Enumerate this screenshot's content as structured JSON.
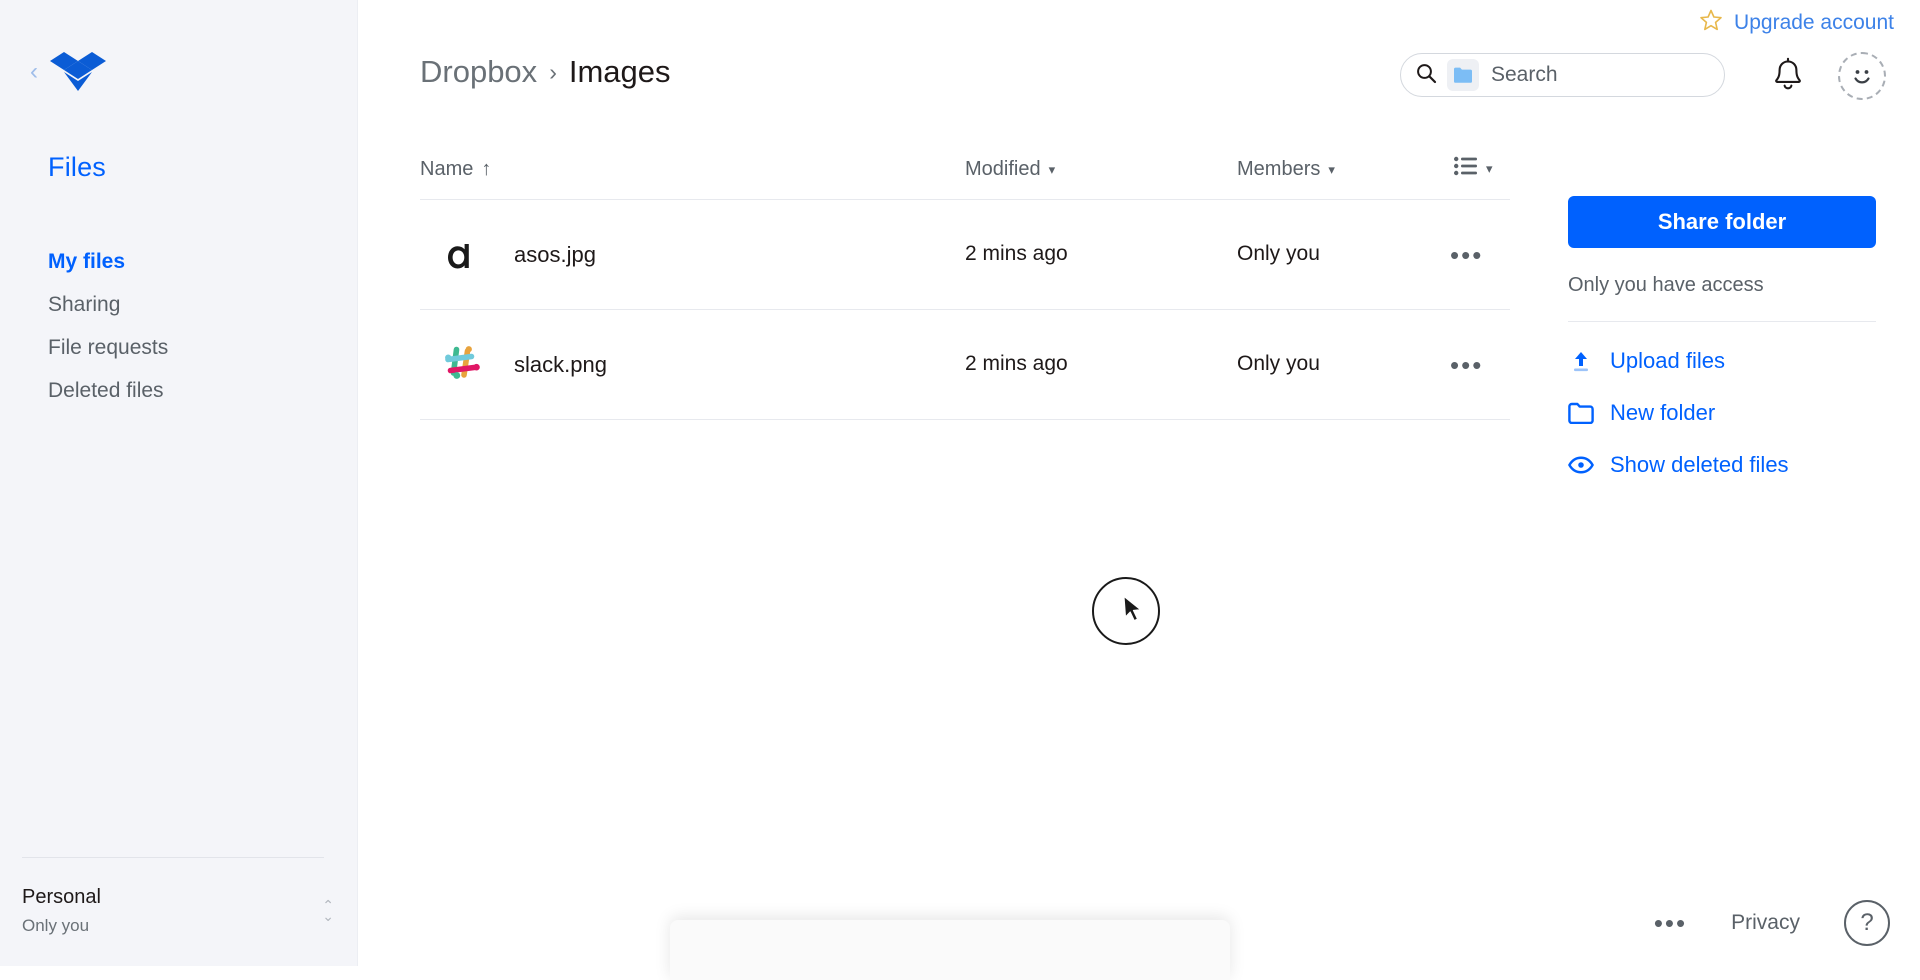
{
  "app": {
    "name": "Dropbox",
    "logo_color": "#0061fe"
  },
  "sidebar": {
    "collapse_icon": "chevron-left-icon",
    "logo_icon": "dropbox-logo-icon",
    "heading": "Files",
    "items": [
      {
        "label": "My files",
        "active": true
      },
      {
        "label": "Sharing",
        "active": false
      },
      {
        "label": "File requests",
        "active": false
      },
      {
        "label": "Deleted files",
        "active": false
      }
    ],
    "account": {
      "name": "Personal",
      "sub": "Only you",
      "stepper_up": "⌃",
      "stepper_down": "⌄"
    }
  },
  "topbar": {
    "upgrade": {
      "icon": "star-icon",
      "label": "Upgrade account",
      "color": "#3d82e8"
    },
    "search": {
      "icon": "search-icon",
      "chip_icon": "folder-icon",
      "placeholder": "Search",
      "value": ""
    },
    "notifications_icon": "bell-icon",
    "avatar_icon": "smiley-avatar-icon"
  },
  "breadcrumb": {
    "root": "Dropbox",
    "separator": "›",
    "current": "Images"
  },
  "table": {
    "columns": {
      "name": {
        "label": "Name",
        "sort_indicator": "↑"
      },
      "modified": {
        "label": "Modified",
        "caret": "▾"
      },
      "members": {
        "label": "Members",
        "caret": "▾"
      },
      "view": {
        "icon": "list-view-icon",
        "caret": "▾"
      }
    },
    "rows": [
      {
        "icon": "asos-logo-icon",
        "name": "asos.jpg",
        "modified": "2 mins ago",
        "members": "Only you",
        "more": "•••"
      },
      {
        "icon": "slack-logo-icon",
        "name": "slack.png",
        "modified": "2 mins ago",
        "members": "Only you",
        "more": "•••"
      }
    ]
  },
  "right_panel": {
    "share_button": "Share folder",
    "share_button_color": "#0061fe",
    "access_note": "Only you have access",
    "actions": [
      {
        "icon": "upload-icon",
        "label": "Upload files"
      },
      {
        "icon": "new-folder-icon",
        "label": "New folder"
      },
      {
        "icon": "eye-icon",
        "label": "Show deleted files"
      }
    ]
  },
  "footer": {
    "more": "•••",
    "privacy": "Privacy",
    "help": "?"
  },
  "cursor": {
    "halo_icon": "click-halo",
    "pointer_icon": "mouse-pointer-icon"
  }
}
